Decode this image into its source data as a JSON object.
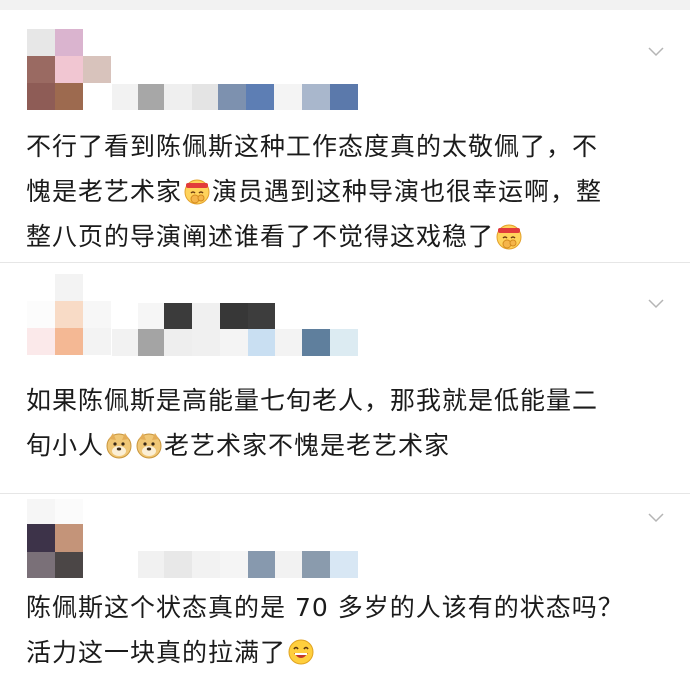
{
  "comments": [
    {
      "segments": [
        {
          "type": "text",
          "value": "不行了看到陈佩斯这种工作态度真的太敬佩了，不",
          "newline_after": true
        },
        {
          "type": "text",
          "value": "愧是老艺术家"
        },
        {
          "type": "emoji",
          "icon": "respect-face-emoji"
        },
        {
          "type": "text",
          "value": "演员遇到这种导演也很幸运啊，整",
          "newline_after": true
        },
        {
          "type": "text",
          "value": "整八页的导演阐述谁看了不觉得这戏稳了"
        },
        {
          "type": "emoji",
          "icon": "respect-face-emoji"
        }
      ]
    },
    {
      "segments": [
        {
          "type": "text",
          "value": "如果陈佩斯是高能量七旬老人，那我就是低能量二",
          "newline_after": true
        },
        {
          "type": "text",
          "value": "旬小人"
        },
        {
          "type": "emoji",
          "icon": "doge-emoji"
        },
        {
          "type": "emoji",
          "icon": "doge-emoji"
        },
        {
          "type": "text",
          "value": "老艺术家不愧是老艺术家"
        }
      ]
    },
    {
      "segments": [
        {
          "type": "text",
          "value": "陈佩斯这个状态真的是 70 多岁的人该有的状态吗？",
          "newline_after": true
        },
        {
          "type": "text",
          "value": "活力这一块真的拉满了"
        },
        {
          "type": "emoji",
          "icon": "laughing-face-emoji"
        }
      ]
    }
  ],
  "icons": {
    "chevron": "chevron-down-icon",
    "avatar": "pixelated-avatar",
    "username": "pixelated-username"
  },
  "colors": {
    "text": "#1b1b1b",
    "divider": "#e6e6e6",
    "chevron": "#b5b5b5",
    "top_strip": "#f2f2f2"
  }
}
